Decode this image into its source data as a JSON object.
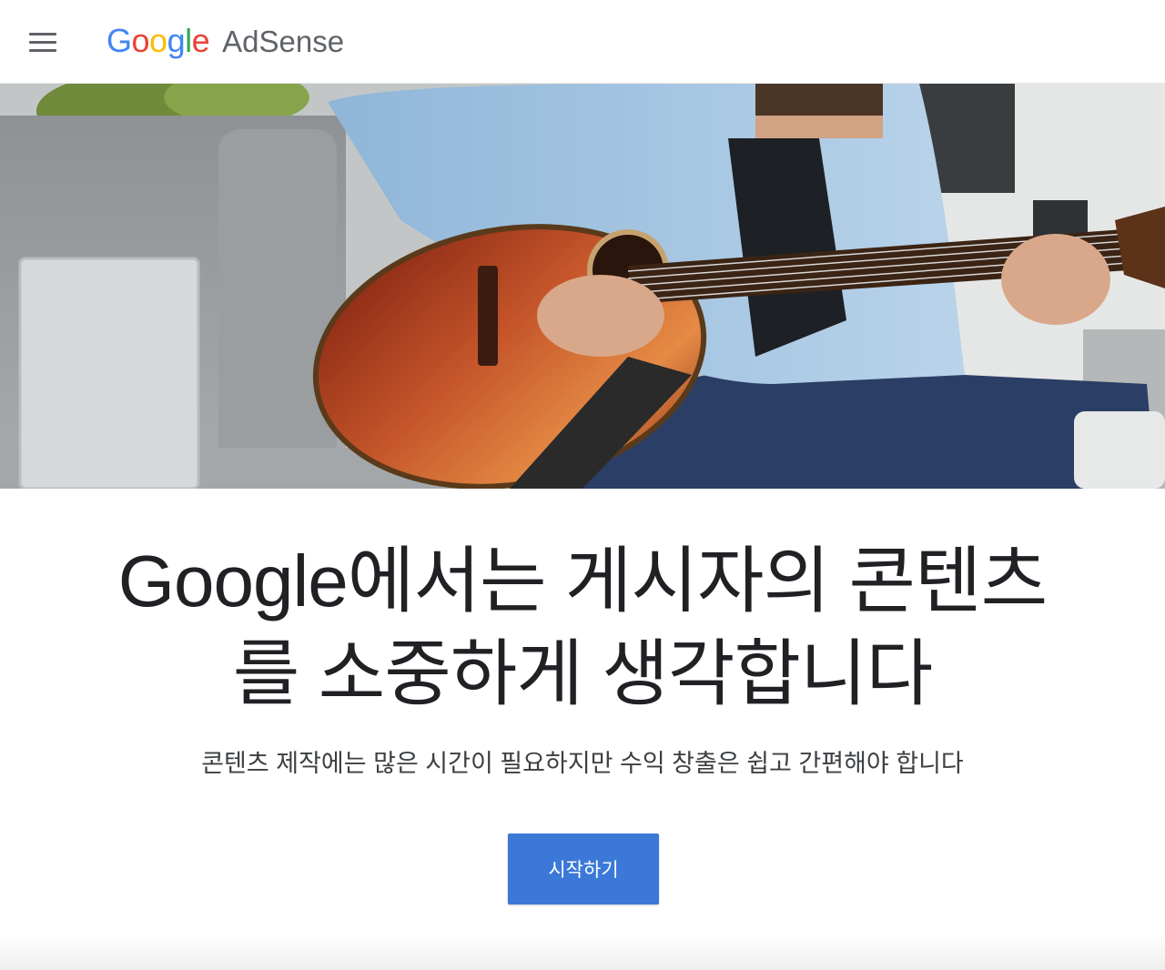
{
  "header": {
    "menu_icon": "hamburger-menu-icon",
    "logo": {
      "brand_letters": [
        {
          "char": "G",
          "color": "#4285F4"
        },
        {
          "char": "o",
          "color": "#EA4335"
        },
        {
          "char": "o",
          "color": "#FBBC05"
        },
        {
          "char": "g",
          "color": "#4285F4"
        },
        {
          "char": "l",
          "color": "#34A853"
        },
        {
          "char": "e",
          "color": "#EA4335"
        }
      ],
      "product": "AdSense"
    }
  },
  "hero": {
    "image": "man-playing-acoustic-guitar-photo"
  },
  "main": {
    "headline_line1": "Google에서는 게시자의 콘텐츠",
    "headline_line2": "를 소중하게 생각합니다",
    "subheadline": "콘텐츠 제작에는 많은 시간이 필요하지만 수익 창출은 쉽고 간편해야 합니다",
    "cta_label": "시작하기"
  },
  "colors": {
    "cta_background": "#3c78d8",
    "text_primary": "#202124",
    "text_secondary": "#3c4043"
  }
}
